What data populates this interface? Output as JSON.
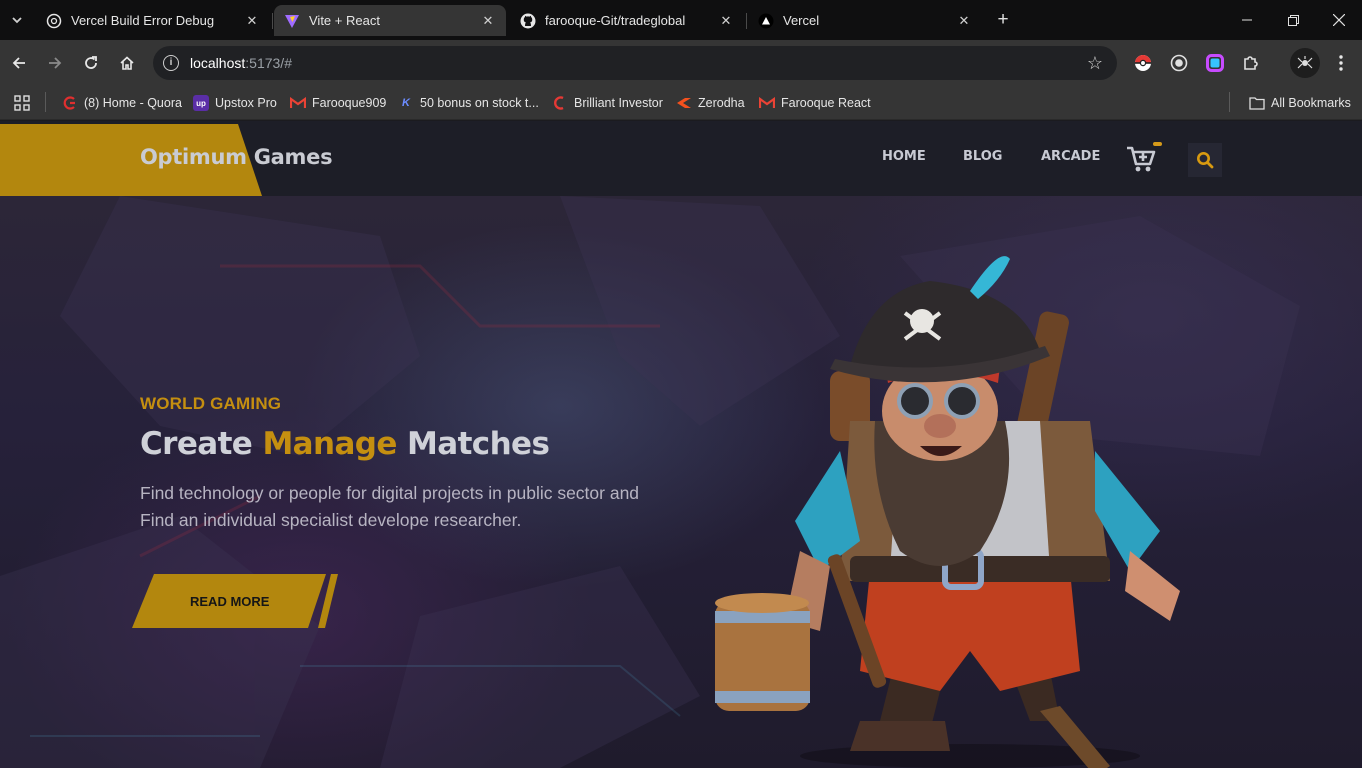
{
  "browser": {
    "tabs": [
      {
        "title": "Vercel Build Error Debug",
        "icon": "chatgpt-icon"
      },
      {
        "title": "Vite + React",
        "icon": "vite-icon"
      },
      {
        "title": "farooque-Git/tradeglobal",
        "icon": "github-icon"
      },
      {
        "title": "Vercel",
        "icon": "vercel-icon"
      }
    ],
    "new_tab_label": "+",
    "address": {
      "host": "localhost",
      "rest": ":5173/#"
    },
    "bookmarks": [
      {
        "label": "(8) Home - Quora",
        "icon": "quora-icon"
      },
      {
        "label": "Upstox Pro",
        "icon": "upstox-icon"
      },
      {
        "label": "Farooque909",
        "icon": "gmail-icon"
      },
      {
        "label": "50 bonus on stock t...",
        "icon": "kite-icon"
      },
      {
        "label": "Brilliant Investor",
        "icon": "brilliant-icon"
      },
      {
        "label": "Zerodha",
        "icon": "zerodha-icon"
      },
      {
        "label": "Farooque React",
        "icon": "gmail-icon"
      }
    ],
    "all_bookmarks_label": "All Bookmarks"
  },
  "site": {
    "logo": "Optimum Games",
    "nav": [
      "HOME",
      "BLOG",
      "ARCADE"
    ],
    "hero": {
      "eyebrow": "WORLD GAMING",
      "headline_part1": "Create",
      "headline_highlight": "Manage",
      "headline_part2": "Matches",
      "description": "Find technology or people for digital projects in public sector and Find an individual specialist develope researcher.",
      "cta": "READ MORE"
    }
  },
  "colors": {
    "accent": "#b3870e",
    "header_bg": "#1d1e27",
    "text_light": "#cfd1d8"
  }
}
